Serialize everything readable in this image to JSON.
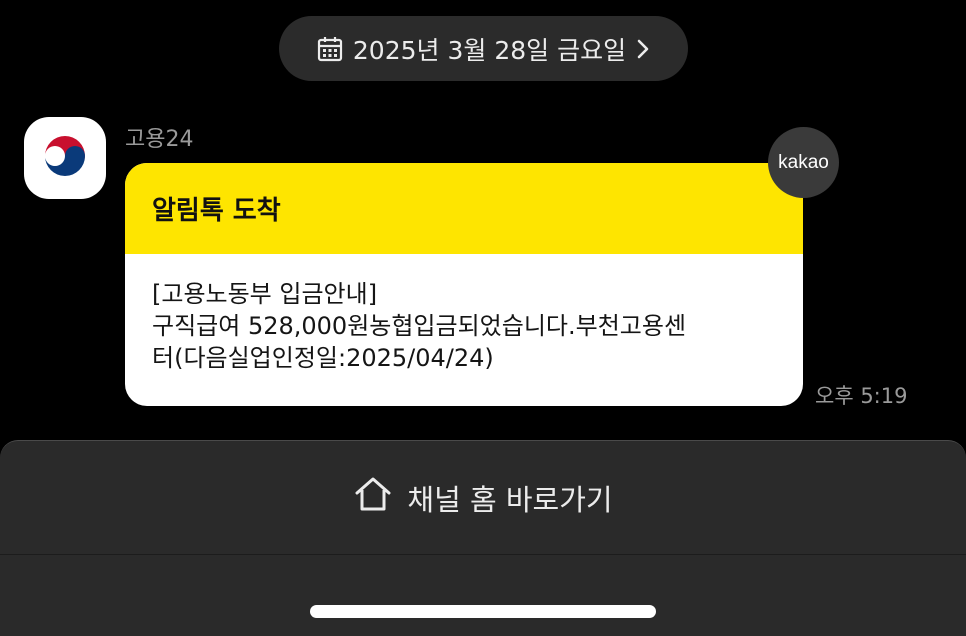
{
  "date_pill": {
    "label": "2025년 3월 28일 금요일",
    "icon": "calendar-icon",
    "chevron": "chevron-right-icon"
  },
  "message": {
    "sender": "고용24",
    "avatar_icon": "taegeuk-logo-icon",
    "header": "알림톡 도착",
    "lines": [
      "[고용노동부 입금안내]",
      "구직급여 528,000원농협입금되었습니다.부천고용센",
      "터(다음실업인정일:2025/04/24)"
    ],
    "badge": "kakao",
    "time": "오후 5:19"
  },
  "bottom_bar": {
    "channel_home_label": "채널 홈 바로가기",
    "icon": "home-icon"
  },
  "colors": {
    "background": "#000000",
    "bubble_header": "#fee500",
    "bubble_body": "#ffffff",
    "pill": "#2b2b2b",
    "sheet": "#2a2a2a"
  }
}
